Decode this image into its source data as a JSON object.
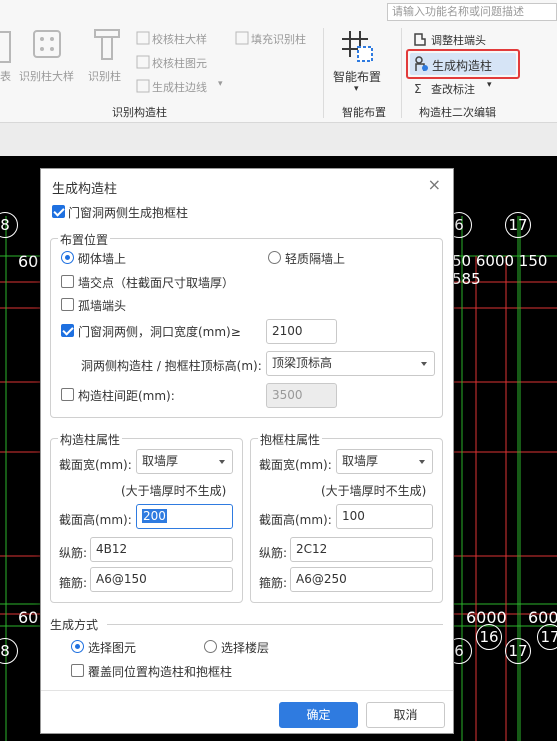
{
  "search": {
    "placeholder": "请输入功能名称或问题描述"
  },
  "ribbon": {
    "items": {
      "biao": "表",
      "identify_big": "识别柱大样",
      "identify_col": "识别柱",
      "check_big": "校核柱大样",
      "check_graph": "校核柱图元",
      "gen_edge": "生成柱边线",
      "fill_identify": "填充识别柱",
      "smart_layout": "智能布置",
      "adjust_end": "调整柱端头",
      "gen_struct": "生成构造柱",
      "check_mark": "查改标注"
    },
    "groups": {
      "identify": "识别构造柱",
      "smart": "智能布置",
      "second_edit": "构造柱二次编辑"
    }
  },
  "dialog": {
    "title": "生成构造柱",
    "close": "×",
    "door_window_frame": "门窗洞两侧生成抱框柱",
    "layout": {
      "legend": "布置位置",
      "masonry": "砌体墙上",
      "light_partition": "轻质隔墙上",
      "wall_intersection": "墙交点（柱截面尺寸取墙厚）",
      "solitary_end": "孤墙端头",
      "door_window_sides": "门窗洞两侧，洞口宽度(mm)≥",
      "door_width_value": "2100",
      "top_elevation_label": "洞两侧构造柱 / 抱框柱顶标高(m):",
      "top_elevation_value": "顶梁顶标高",
      "spacing_label": "构造柱间距(mm):",
      "spacing_value": "3500"
    },
    "struct_col": {
      "legend": "构造柱属性",
      "width_label": "截面宽(mm):",
      "width_value": "取墙厚",
      "note": "(大于墙厚时不生成)",
      "height_label": "截面高(mm):",
      "height_value": "200",
      "long_label": "纵筋:",
      "long_value": "4B12",
      "stirrup_label": "箍筋:",
      "stirrup_value": "A6@150"
    },
    "frame_col": {
      "legend": "抱框柱属性",
      "width_label": "截面宽(mm):",
      "width_value": "取墙厚",
      "note": "(大于墙厚时不生成)",
      "height_label": "截面高(mm):",
      "height_value": "100",
      "long_label": "纵筋:",
      "long_value": "2C12",
      "stirrup_label": "箍筋:",
      "stirrup_value": "A6@250"
    },
    "gen_mode": {
      "legend": "生成方式",
      "select_graph": "选择图元",
      "select_floor": "选择楼层",
      "cover": "覆盖同位置构造柱和抱框柱"
    },
    "ok": "确定",
    "cancel": "取消"
  },
  "cad": {
    "left_8_top": "8",
    "left_60_top": "60",
    "right_6_top": "6",
    "right_17_top": "17",
    "right_dims_top": "50 6000 150 585",
    "left_60_bot": "60",
    "left_8_bot": "8",
    "right_6_bot": "6",
    "right_6000_bot": "6000",
    "right_600_bot": "600",
    "right_16_bot": "16",
    "right_17_bot": "17",
    "right_17_bot2": "17"
  }
}
